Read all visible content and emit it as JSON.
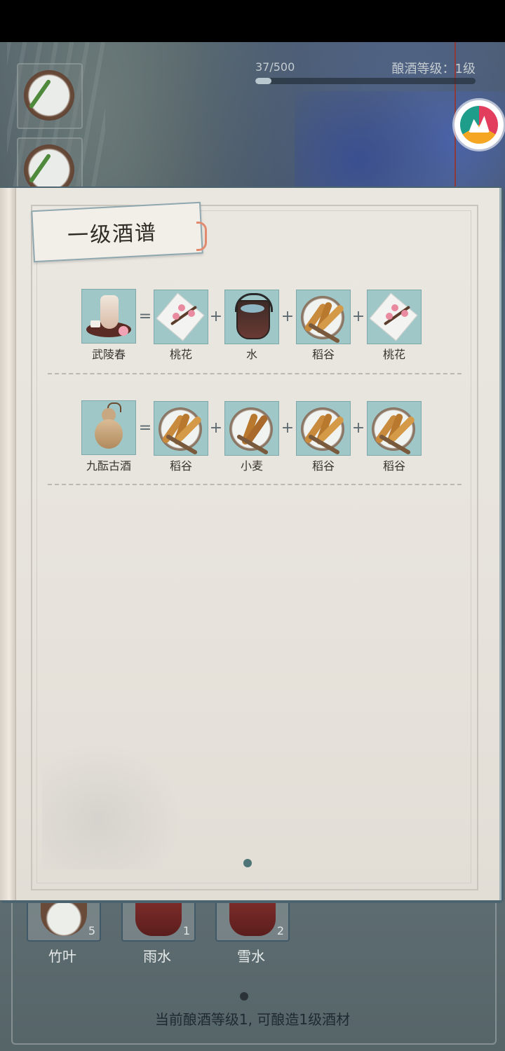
{
  "header": {
    "exp_text": "37/500",
    "exp_fraction": 0.074,
    "level_text": "酿酒等级：1级"
  },
  "book": {
    "title": "一级酒谱",
    "recipes": [
      {
        "result": {
          "name": "武陵春",
          "icon": "wine-bottle-icon"
        },
        "ingredients": [
          {
            "name": "桃花",
            "icon": "peach-blossom-icon"
          },
          {
            "name": "水",
            "icon": "water-bucket-icon"
          },
          {
            "name": "稻谷",
            "icon": "rice-grain-icon"
          },
          {
            "name": "桃花",
            "icon": "peach-blossom-icon"
          }
        ]
      },
      {
        "result": {
          "name": "九酝古酒",
          "icon": "gourd-icon"
        },
        "ingredients": [
          {
            "name": "稻谷",
            "icon": "rice-grain-icon"
          },
          {
            "name": "小麦",
            "icon": "wheat-icon"
          },
          {
            "name": "稻谷",
            "icon": "rice-grain-icon"
          },
          {
            "name": "稻谷",
            "icon": "rice-grain-icon"
          }
        ]
      }
    ],
    "operators": {
      "equals": "=",
      "plus": "+"
    }
  },
  "inventory": {
    "items": [
      {
        "name": "竹叶",
        "count": "5"
      },
      {
        "name": "雨水",
        "count": "1"
      },
      {
        "name": "雪水",
        "count": "2"
      }
    ],
    "hint": "当前酿酒等级1, 可酿造1级酒材"
  },
  "colors": {
    "item_bg": "#9fc7c8",
    "page_bg": "#e7e3dc",
    "accent": "#4e7477"
  }
}
